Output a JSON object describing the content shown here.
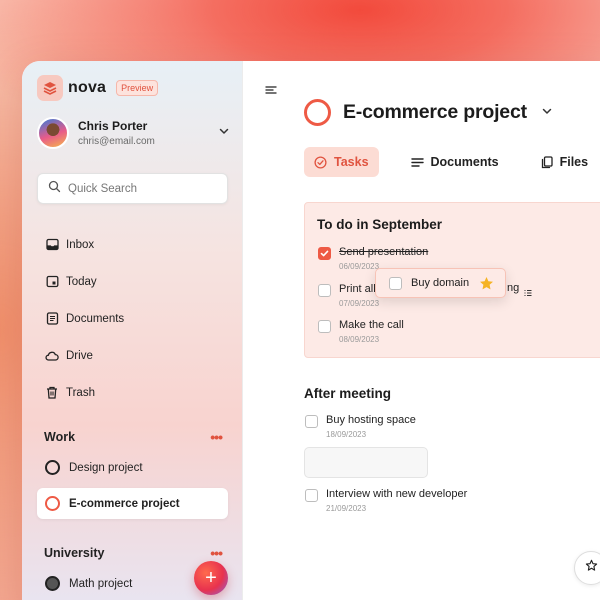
{
  "sidebar": {
    "brand": {
      "name": "nova",
      "badge": "Preview"
    },
    "user": {
      "name": "Chris Porter",
      "email": "chris@email.com"
    },
    "search": {
      "placeholder": "Quick Search"
    },
    "nav": [
      {
        "label": "Inbox",
        "icon": "inbox-icon"
      },
      {
        "label": "Today",
        "icon": "calendar-icon"
      },
      {
        "label": "Documents",
        "icon": "document-icon"
      },
      {
        "label": "Drive",
        "icon": "cloud-icon"
      },
      {
        "label": "Trash",
        "icon": "trash-icon"
      }
    ],
    "sections": [
      {
        "title": "Work",
        "projects": [
          "Design project",
          "E-commerce project"
        ],
        "active": "E-commerce project"
      },
      {
        "title": "University",
        "projects": [
          "Math project"
        ]
      }
    ],
    "fab_label": "+"
  },
  "main": {
    "project_title": "E-commerce project",
    "tabs": [
      {
        "label": "Tasks",
        "icon": "check-circle-icon",
        "active": true
      },
      {
        "label": "Documents",
        "icon": "lines-icon",
        "active": false
      },
      {
        "label": "Files",
        "icon": "files-icon",
        "active": false
      }
    ],
    "todo_section": {
      "title": "To do in September",
      "tasks": [
        {
          "title": "Send presentation",
          "date": "06/09/2023",
          "done": true
        },
        {
          "title": "Print all",
          "date": "07/09/2023",
          "done": false,
          "hidden_suffix": "ng"
        },
        {
          "title": "Make the call",
          "date": "08/09/2023",
          "done": false
        }
      ]
    },
    "dragging_task": {
      "title": "Buy domain",
      "starred": true
    },
    "after_section": {
      "title": "After meeting",
      "tasks": [
        {
          "title": "Buy hosting space",
          "date": "18/09/2023",
          "done": false
        },
        {
          "title": "Interview with new developer",
          "date": "21/09/2023",
          "done": false
        }
      ]
    }
  },
  "colors": {
    "accent": "#ee5a45",
    "accent_soft": "#fcdcd4",
    "star": "#f5b323"
  }
}
